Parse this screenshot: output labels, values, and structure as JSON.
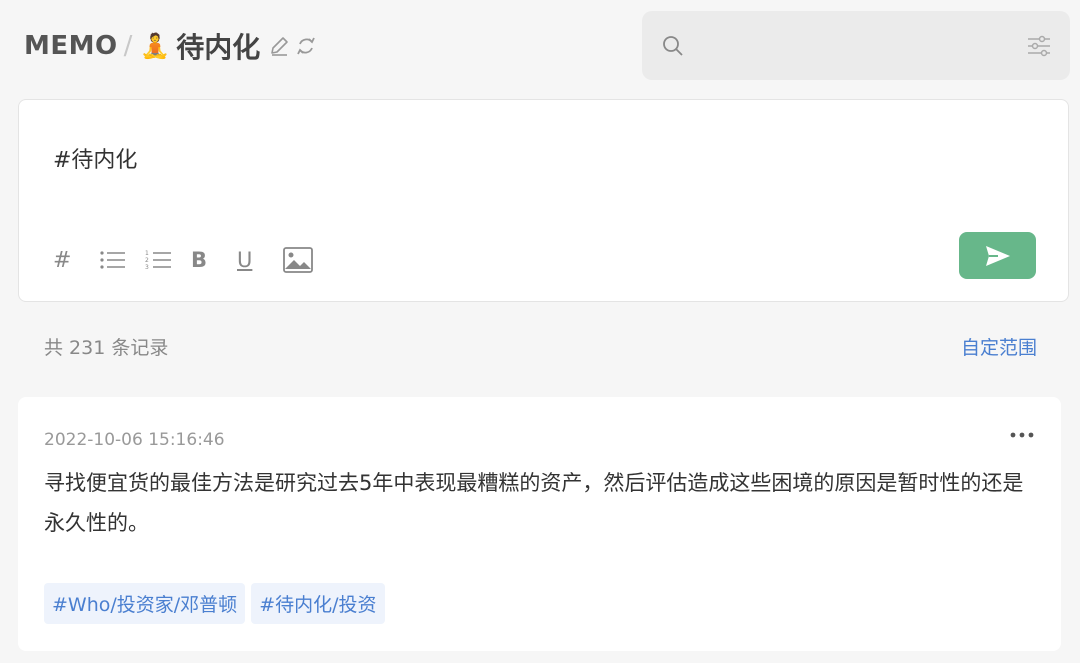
{
  "header": {
    "brand": "MEMO",
    "separator": "/",
    "emoji": "🧘",
    "tag_title": "待内化",
    "edit_icon": "pencil-icon",
    "sync_icon": "sync-icon"
  },
  "search": {
    "placeholder": "",
    "value": "",
    "search_icon": "search-icon",
    "filter_icon": "filter-sliders-icon"
  },
  "editor": {
    "content": "#待内化",
    "toolbar": {
      "hash": "#",
      "bold": "B",
      "underline": "U",
      "icons": [
        "hashtag-icon",
        "bullet-list-icon",
        "numbered-list-icon",
        "bold-icon",
        "underline-icon",
        "image-icon"
      ]
    },
    "send_icon": "send-icon"
  },
  "summary": {
    "count_text": "共 231 条记录",
    "range_link": "自定范围"
  },
  "memos": [
    {
      "time": "2022-10-06 15:16:46",
      "text": "寻找便宜货的最佳方法是研究过去5年中表现最糟糕的资产，然后评估造成这些困境的原因是暂时性的还是永久性的。",
      "tags": [
        "#Who/投资家/邓普顿",
        "#待内化/投资"
      ],
      "more_icon": "more-dots-icon"
    }
  ],
  "colors": {
    "accent_green": "#67b78a",
    "link_blue": "#4a7fd0",
    "tag_bg": "#eef3fc",
    "background": "#f6f6f6"
  }
}
